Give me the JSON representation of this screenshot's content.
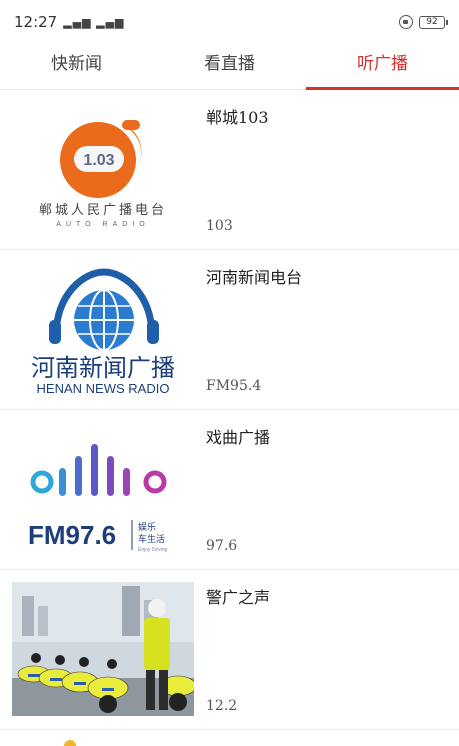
{
  "status": {
    "time": "12:27",
    "signal": "▂▄▆ ▂▄▆",
    "battery": "92"
  },
  "tabs": [
    {
      "label": "快新闻",
      "active": false
    },
    {
      "label": "看直播",
      "active": false
    },
    {
      "label": "听广播",
      "active": true
    }
  ],
  "accent_color": "#d7312c",
  "stations": [
    {
      "name": "郸城103",
      "frequency": "103",
      "logo": {
        "badge": "1.03",
        "cn": "郸城人民广播电台",
        "en": "AUTO RADIO"
      }
    },
    {
      "name": "河南新闻电台",
      "frequency": "FM95.4",
      "logo": {
        "cn": "河南新闻广播",
        "en": "HENAN NEWS RADIO"
      }
    },
    {
      "name": "戏曲广播",
      "frequency": "97.6",
      "logo": {
        "fm": "FM97.6",
        "tag1": "娱乐",
        "tag2": "车生活",
        "tag3": "Enjoy Driving"
      }
    },
    {
      "name": "警广之声",
      "frequency": "12.2",
      "logo": {}
    }
  ]
}
